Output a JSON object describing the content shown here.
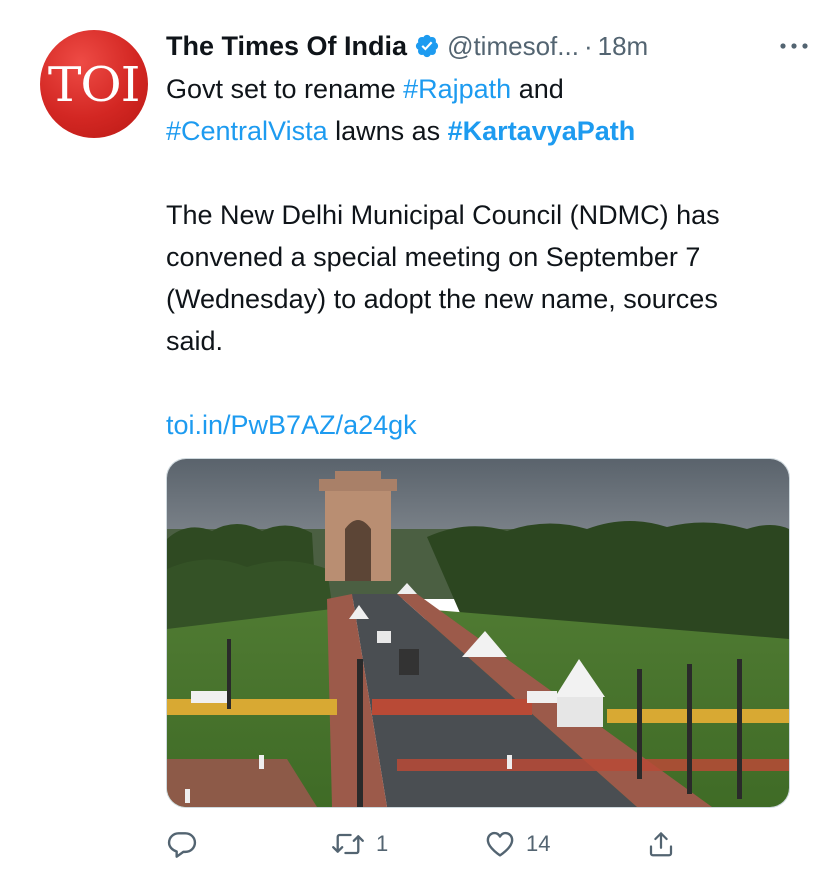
{
  "account": {
    "display_name": "The Times Of India",
    "handle": "@timesof...",
    "separator": "·",
    "time": "18m",
    "avatar_text": "TOI"
  },
  "tweet": {
    "line1_pre": "Govt set to rename ",
    "hashtag_rajpath": "#Rajpath",
    "line1_post": " and",
    "hashtag_centralvista": "#CentralVista",
    "line2_mid": " lawns as ",
    "hashtag_kartavyapath": "#KartavyaPath",
    "paragraph2": "The New Delhi Municipal Council (NDMC) has convened a special meeting on September 7 (Wednesday) to adopt the new name, sources said.",
    "link": "toi.in/PwB7AZ/a24gk"
  },
  "actions": {
    "reply_count": "",
    "retweet_count": "1",
    "like_count": "14"
  },
  "colors": {
    "accent": "#1d9bf0",
    "secondary_text": "#536471",
    "avatar_red": "#d32723"
  },
  "icons": {
    "verified": "verified-badge-icon",
    "more": "more-icon",
    "reply": "reply-icon",
    "retweet": "retweet-icon",
    "like": "like-icon",
    "share": "share-icon"
  }
}
